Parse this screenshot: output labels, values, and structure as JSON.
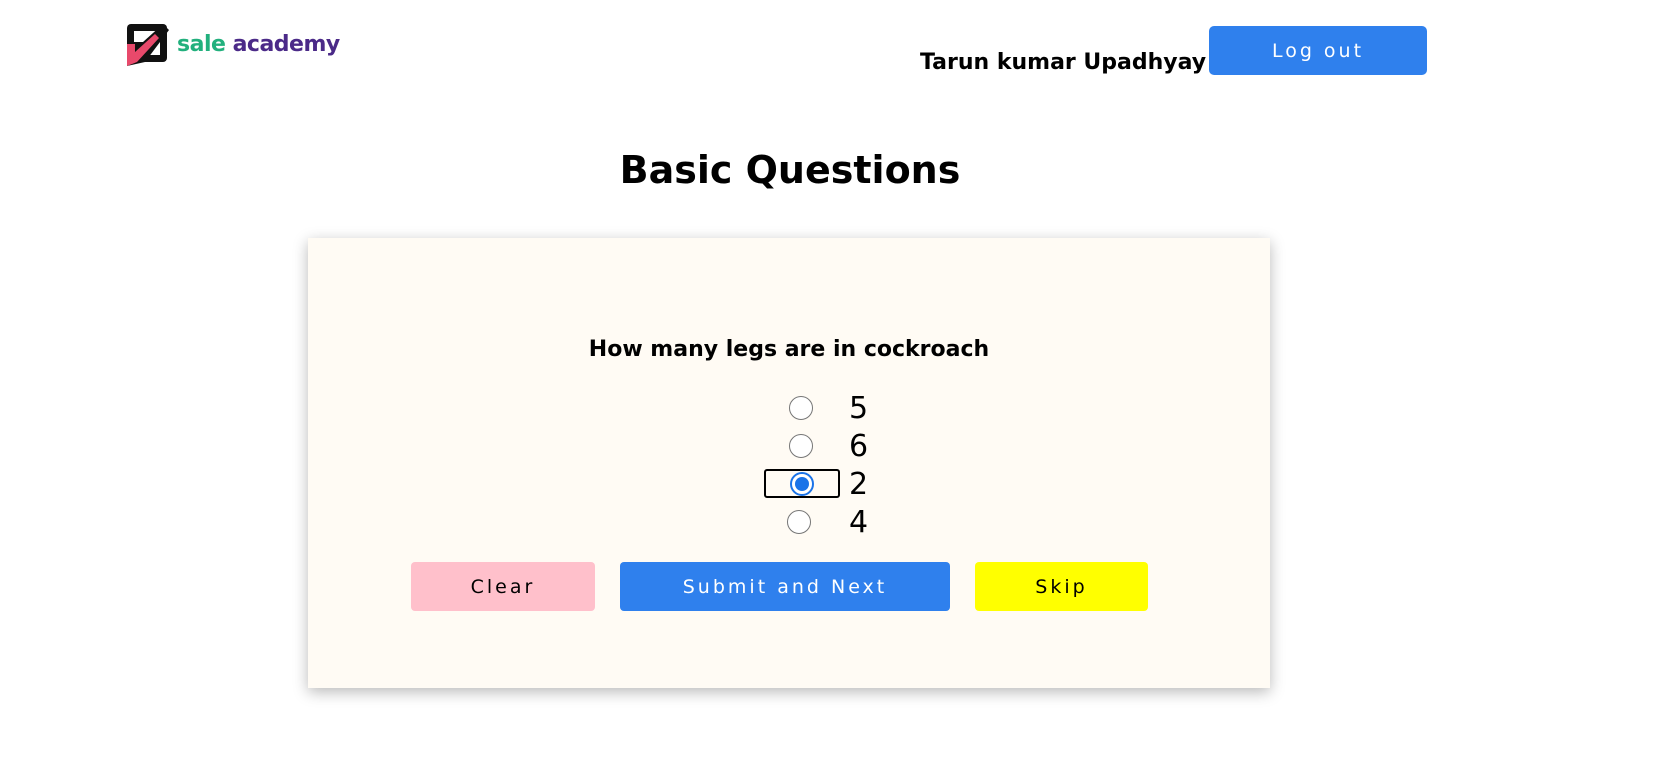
{
  "header": {
    "logo": {
      "word1": "sale",
      "word2": "academy",
      "colors": {
        "word1": "#22b07d",
        "word2": "#4b2a88",
        "mark_dark": "#111111",
        "mark_accent": "#e8496b"
      }
    },
    "user_name": "Tarun kumar Upadhyay",
    "logout_label": "Log out"
  },
  "page_title": "Basic Questions",
  "quiz": {
    "question": "How many legs are in cockroach",
    "options": [
      {
        "label": "5",
        "selected": false
      },
      {
        "label": "6",
        "selected": false
      },
      {
        "label": "2",
        "selected": true
      },
      {
        "label": "4",
        "selected": false
      }
    ],
    "buttons": {
      "clear_label": "Clear",
      "submit_label": "Submit and Next",
      "skip_label": "Skip"
    }
  },
  "colors": {
    "primary": "#2f80ed",
    "clear": "#ffc0cb",
    "skip": "#ffff00",
    "card_bg": "#fffbf4",
    "radio_checked": "#1a73e8"
  }
}
